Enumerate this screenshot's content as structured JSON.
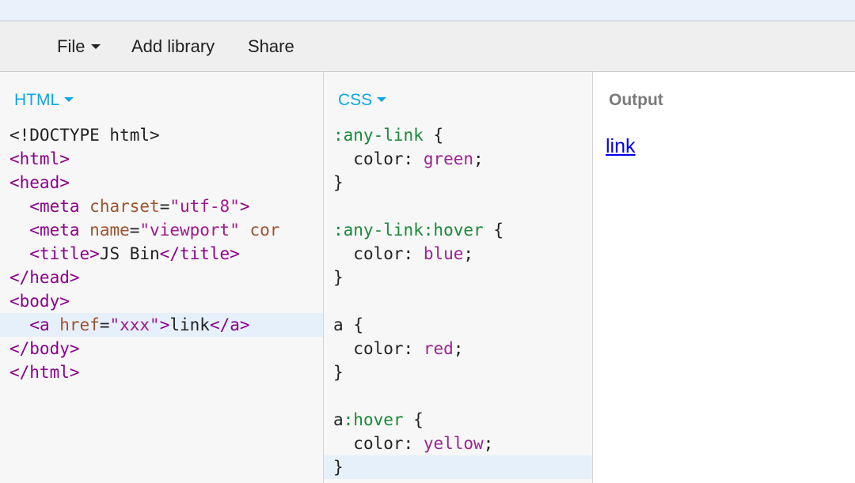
{
  "menubar": {
    "file_label": "File",
    "add_library_label": "Add library",
    "share_label": "Share"
  },
  "panels": {
    "html_label": "HTML",
    "css_label": "CSS",
    "output_label": "Output"
  },
  "html_code": {
    "doctype": "<!DOCTYPE html>",
    "html_open": "<html>",
    "head_open": "<head>",
    "meta1_open": "<meta",
    "meta1_attr": "charset",
    "meta1_eq": "=",
    "meta1_val": "\"utf-8\"",
    "meta1_close": ">",
    "meta2_open": "<meta",
    "meta2_attr": "name",
    "meta2_eq": "=",
    "meta2_val": "\"viewport\"",
    "meta2_trunc": "cor",
    "title_open": "<title>",
    "title_text": "JS Bin",
    "title_close": "</title>",
    "head_close": "</head>",
    "body_open": "<body>",
    "a_open": "<a",
    "a_attr": "href",
    "a_eq": "=",
    "a_val": "\"xxx\"",
    "a_gt": ">",
    "a_text": "link",
    "a_close": "</a>",
    "body_close": "</body>",
    "html_close": "</html>"
  },
  "css_code": {
    "sel1": ":any-link",
    "sel2": ":any-link:hover",
    "sel3": "a",
    "sel4_el": "a",
    "sel4_pseudo": ":hover",
    "brace_open": "{",
    "brace_close": "}",
    "prop": "color:",
    "val1": "green",
    "val2": "blue",
    "val3": "red",
    "val4": "yellow",
    "semi": ";"
  },
  "output": {
    "link_text": "link"
  }
}
